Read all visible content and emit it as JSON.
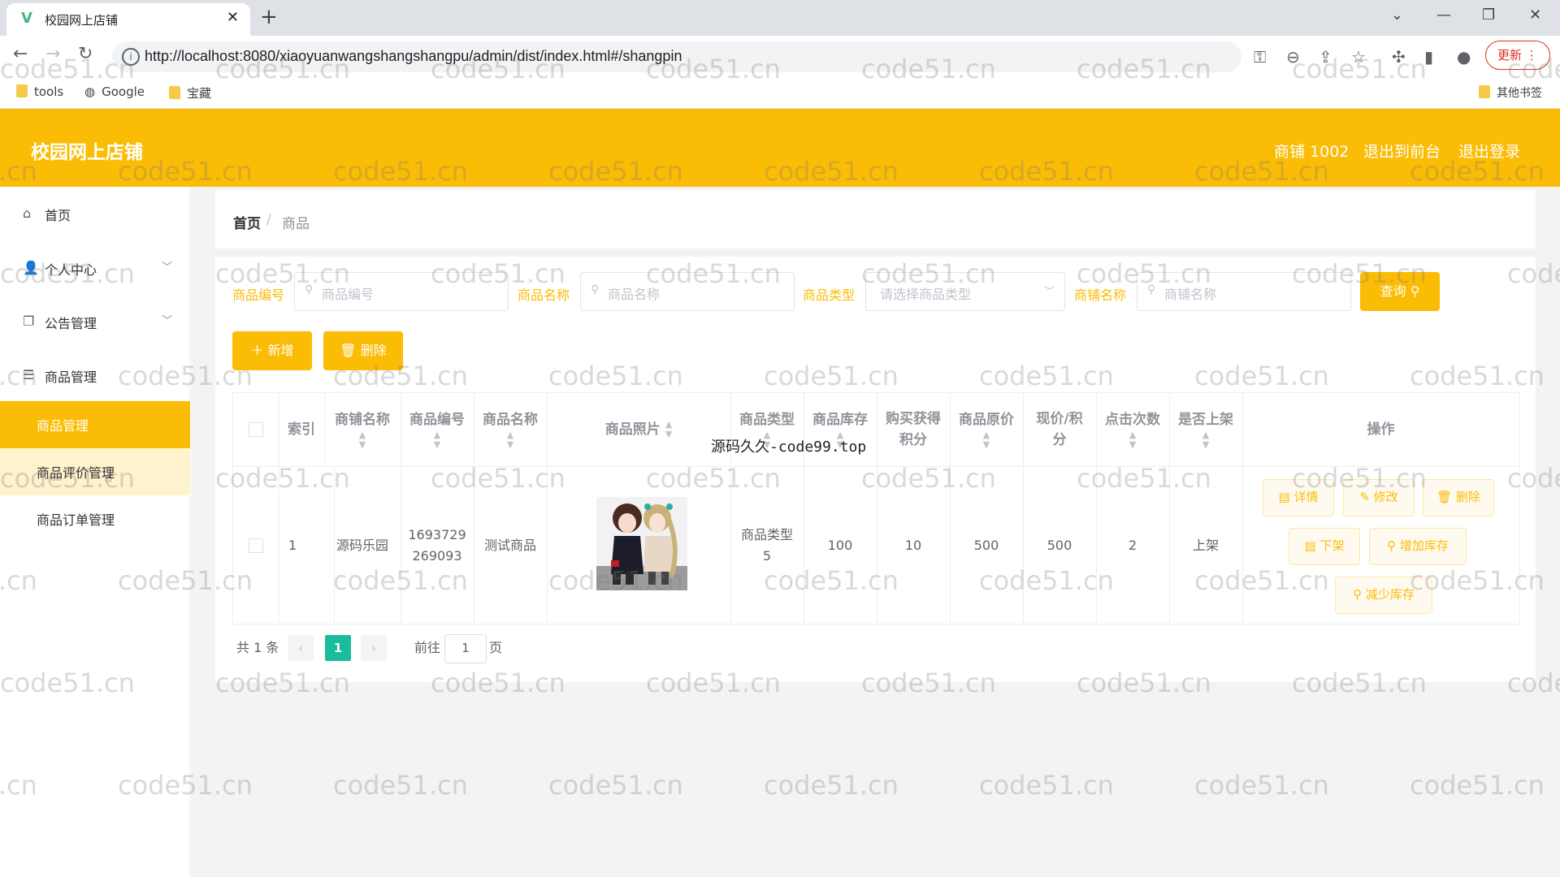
{
  "browser": {
    "tab_title": "校园网上店铺",
    "tab_close": "✕",
    "new_tab": "+",
    "url": "http://localhost:8080/xiaoyuanwangshangshangpu/admin/dist/index.html#/shangpin",
    "update_label": "更新",
    "bookmarks": [
      "tools",
      "Google",
      "宝藏"
    ],
    "other_bookmarks": "其他书签"
  },
  "header": {
    "title": "校园网上店铺",
    "shop": "商铺 1002",
    "to_front": "退出到前台",
    "logout": "退出登录"
  },
  "sidebar": {
    "items": [
      {
        "label": "首页",
        "icon": "home-icon"
      },
      {
        "label": "个人中心",
        "icon": "user-icon"
      },
      {
        "label": "公告管理",
        "icon": "copy-icon"
      },
      {
        "label": "商品管理",
        "icon": "menu-icon"
      }
    ],
    "subitems": [
      "商品管理",
      "商品评价管理",
      "商品订单管理"
    ]
  },
  "breadcrumb": {
    "home": "首页",
    "sep": "/",
    "current": "商品"
  },
  "search": {
    "fields": [
      {
        "label": "商品编号",
        "placeholder": "商品编号"
      },
      {
        "label": "商品名称",
        "placeholder": "商品名称"
      },
      {
        "label": "商品类型",
        "placeholder": "请选择商品类型"
      },
      {
        "label": "商铺名称",
        "placeholder": "商铺名称"
      }
    ],
    "query_label": "查询"
  },
  "actions": {
    "add": "新增",
    "delete": "删除"
  },
  "table": {
    "headers": [
      "索引",
      "商铺名称",
      "商品编号",
      "商品名称",
      "商品照片",
      "商品类型",
      "商品库存",
      "购买获得积分",
      "商品原价",
      "现价/积分",
      "点击次数",
      "是否上架",
      "操作"
    ],
    "headers_display": [
      "索引",
      "商铺名称",
      "商品编号",
      "商品名称",
      "商品照片",
      "商品类型",
      "商品库存",
      "购买获得\n积分",
      "商品原价",
      "现价/积\n分",
      "点击次数",
      "是否上架",
      "操作"
    ],
    "rows": [
      {
        "index": "1",
        "shop": "源码乐园",
        "code": "1693729269093",
        "code_display": "1693729\n269093",
        "name": "测试商品",
        "type": "商品类型5",
        "type_display": "商品类型\n5",
        "stock": "100",
        "points": "10",
        "orig_price": "500",
        "cur_price": "500",
        "clicks": "2",
        "on_shelf": "上架"
      }
    ],
    "row_actions": [
      "详情",
      "修改",
      "删除",
      "下架",
      "增加库存",
      "减少库存"
    ]
  },
  "pagination": {
    "total": "共 1 条",
    "current": "1",
    "goto": "前往",
    "page_value": "1",
    "page_suffix": "页"
  },
  "overlay_text": "源码久久-code99.top",
  "watermark": "code51.cn",
  "colors": {
    "accent": "#fbbc05",
    "pager_active": "#1abc9c"
  }
}
